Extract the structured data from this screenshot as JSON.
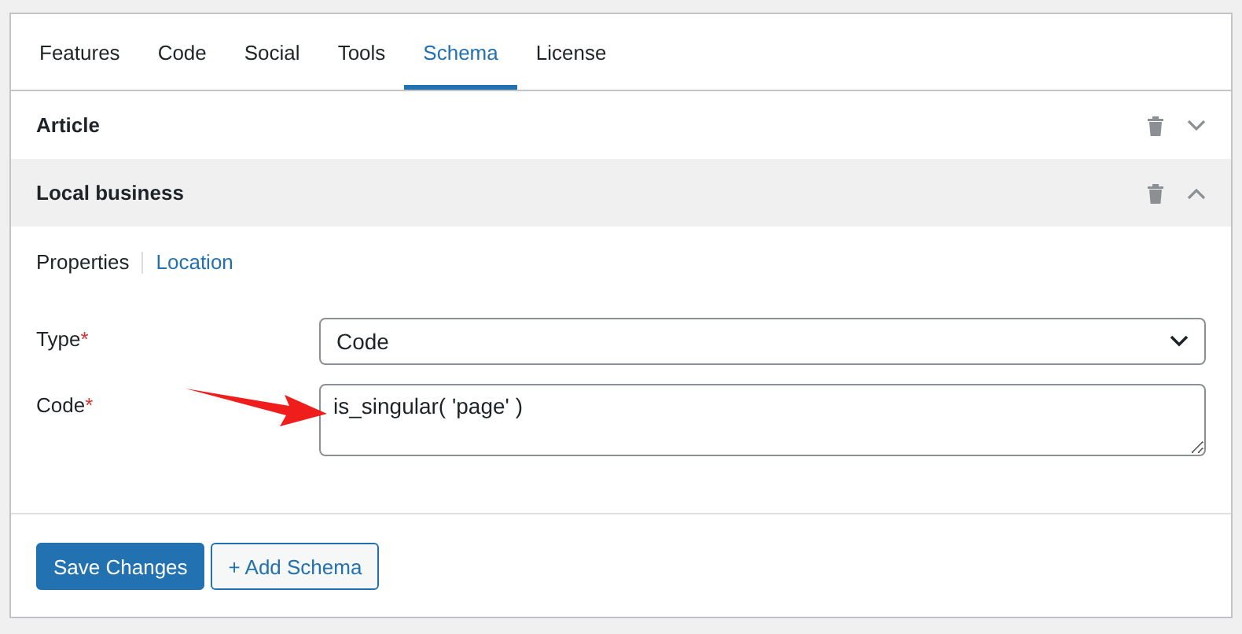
{
  "tabs": [
    {
      "label": "Features",
      "selected": false
    },
    {
      "label": "Code",
      "selected": false
    },
    {
      "label": "Social",
      "selected": false
    },
    {
      "label": "Tools",
      "selected": false
    },
    {
      "label": "Schema",
      "selected": true
    },
    {
      "label": "License",
      "selected": false
    }
  ],
  "sections": [
    {
      "title": "Article",
      "expanded": false
    },
    {
      "title": "Local business",
      "expanded": true
    }
  ],
  "subtabs": [
    {
      "label": "Properties",
      "selected": true
    },
    {
      "label": "Location",
      "selected": false
    }
  ],
  "fields": [
    {
      "label": "Type",
      "required_mark": "*",
      "kind": "select",
      "value": "Code"
    },
    {
      "label": "Code",
      "required_mark": "*",
      "kind": "textarea",
      "value": "is_singular( 'page' )"
    }
  ],
  "buttons": [
    {
      "label": "Save Changes",
      "kind": "primary"
    },
    {
      "label": "+ Add Schema",
      "kind": "secondary"
    }
  ]
}
